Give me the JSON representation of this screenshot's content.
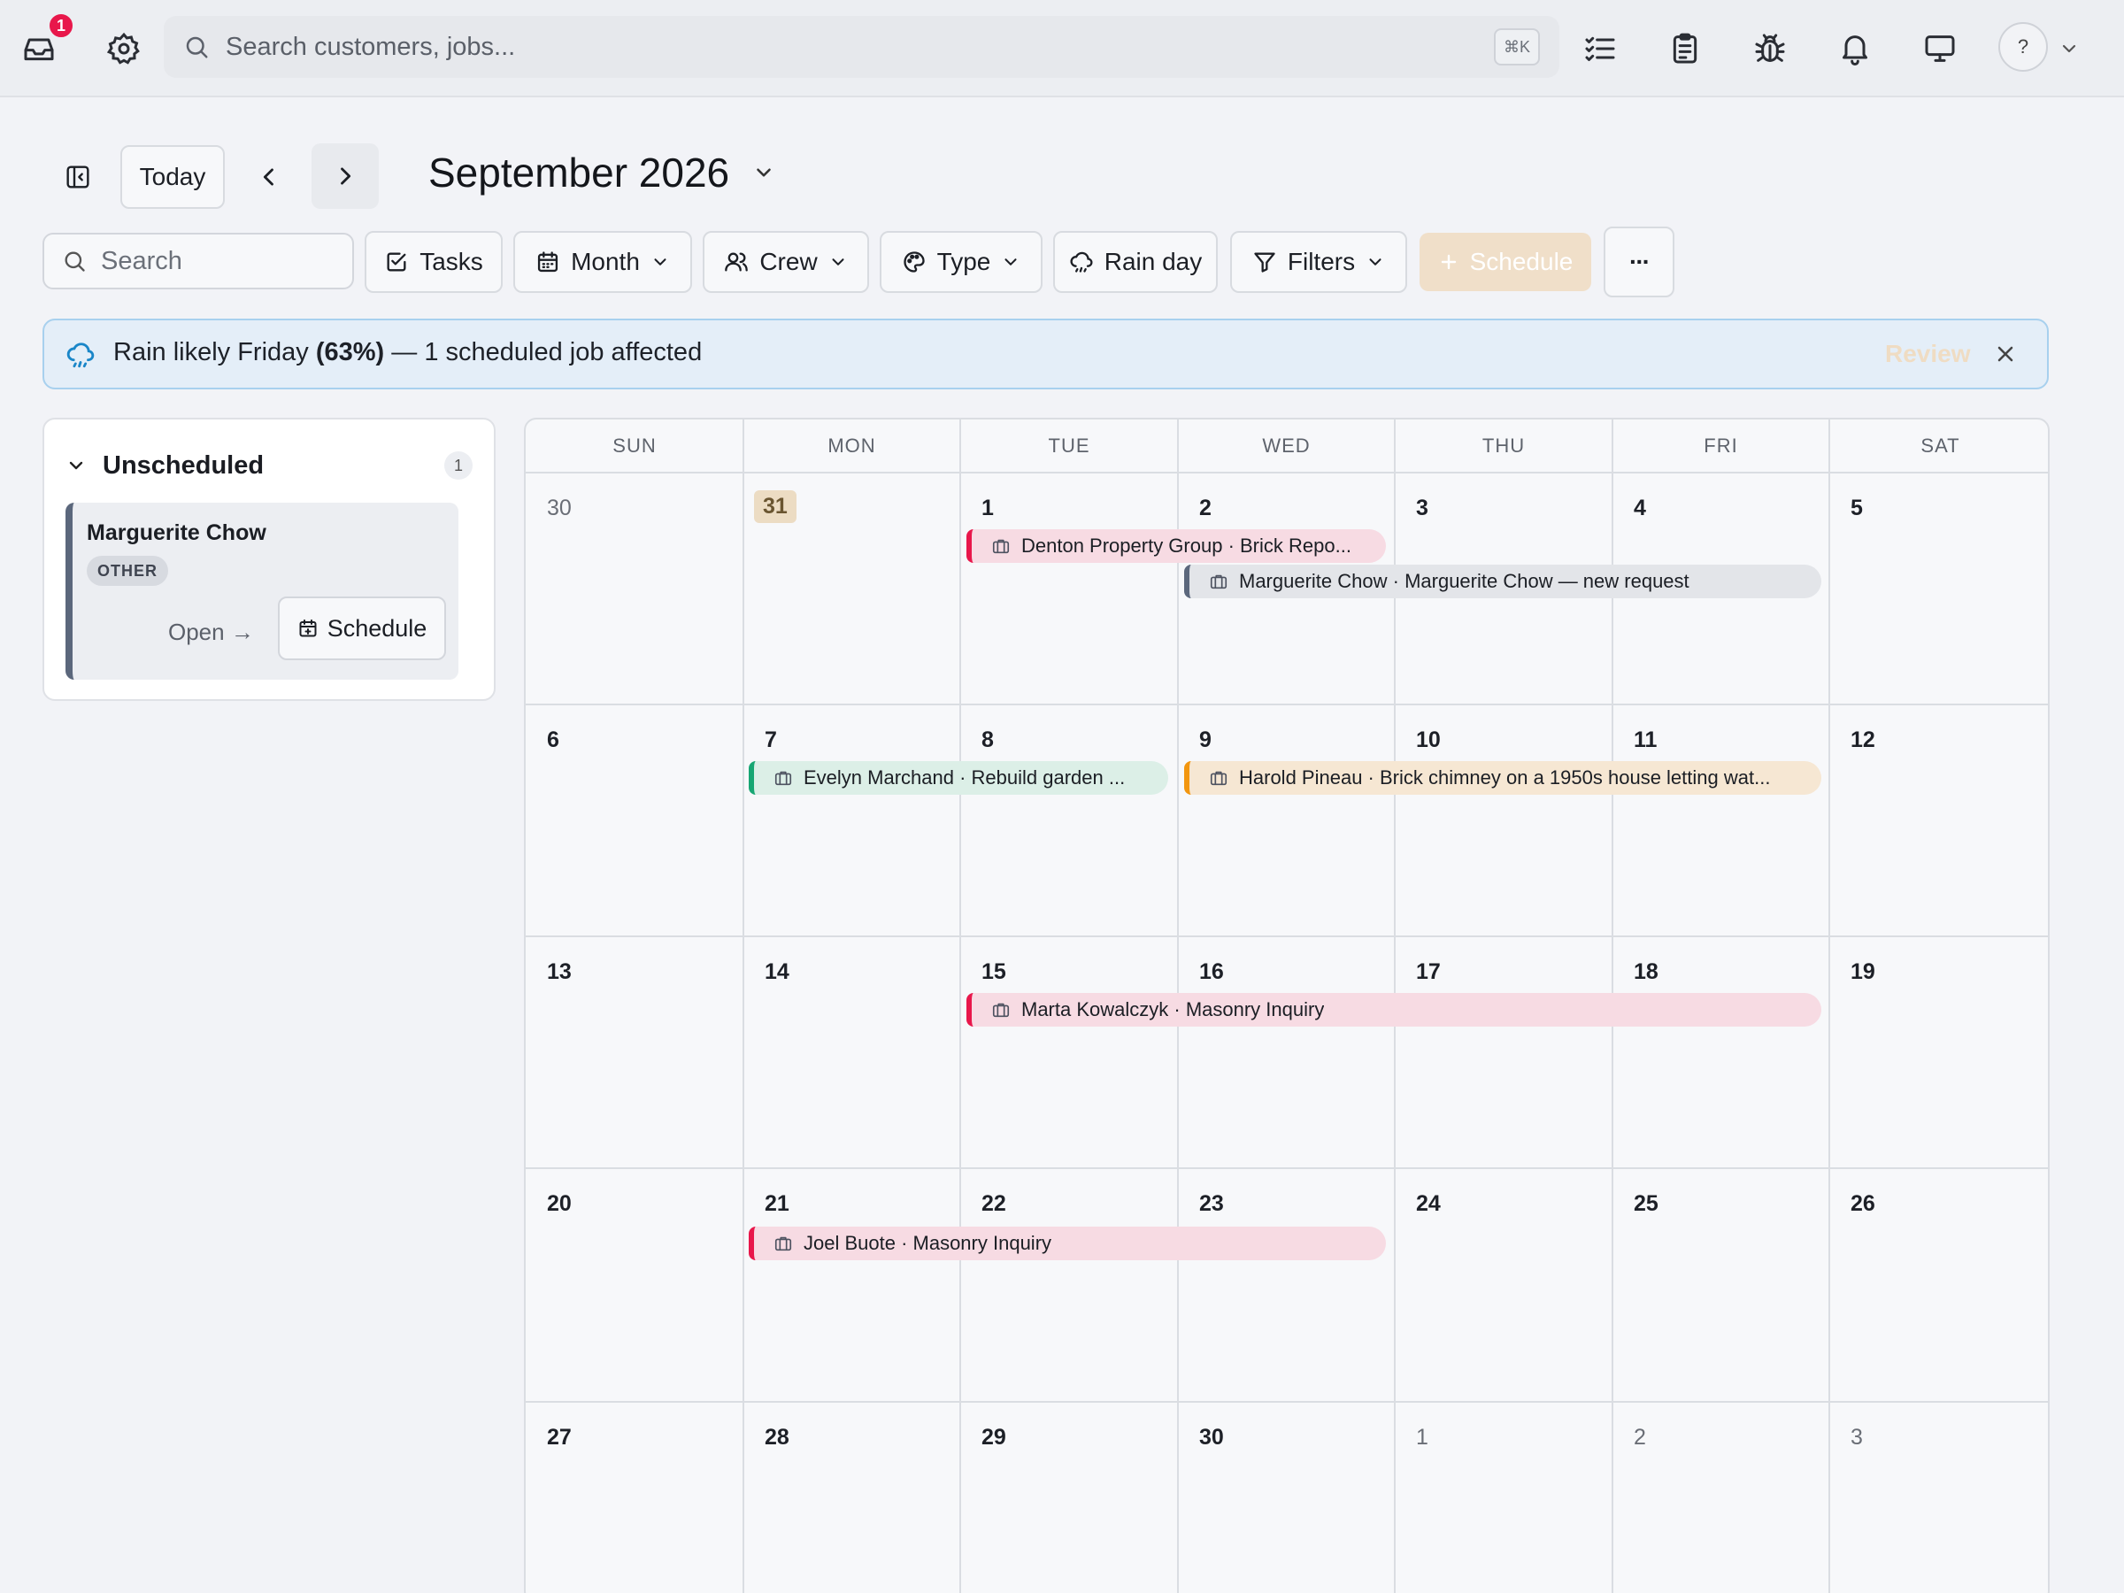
{
  "topbar": {
    "notification_count": "1",
    "search_placeholder": "Search customers, jobs...",
    "shortcut": "⌘K",
    "help_label": "?"
  },
  "header": {
    "today_label": "Today",
    "month_title": "September 2026"
  },
  "filters": {
    "search_placeholder": "Search",
    "tasks_label": "Tasks",
    "view_label": "Month",
    "crew_label": "Crew",
    "type_label": "Type",
    "rain_label": "Rain day",
    "filters_label": "Filters",
    "schedule_label": "Schedule",
    "more_label": "···"
  },
  "banner": {
    "prefix": "Rain likely Friday ",
    "percent": "(63%)",
    "suffix": " — 1 scheduled job affected",
    "action": "Review"
  },
  "unscheduled": {
    "title": "Unscheduled",
    "count": "1",
    "card": {
      "name": "Marguerite Chow",
      "tag": "OTHER",
      "open_label": "Open →",
      "schedule_label": "Schedule"
    }
  },
  "calendar": {
    "weekdays": [
      "SUN",
      "MON",
      "TUE",
      "WED",
      "THU",
      "FRI",
      "SAT"
    ],
    "weeks": [
      [
        "30",
        "31",
        "1",
        "2",
        "3",
        "4",
        "5"
      ],
      [
        "6",
        "7",
        "8",
        "9",
        "10",
        "11",
        "12"
      ],
      [
        "13",
        "14",
        "15",
        "16",
        "17",
        "18",
        "19"
      ],
      [
        "20",
        "21",
        "22",
        "23",
        "24",
        "25",
        "26"
      ],
      [
        "27",
        "28",
        "29",
        "30",
        "1",
        "2",
        "3"
      ]
    ],
    "events": [
      {
        "text": "Denton Property Group · Brick Repo...",
        "color": "#e8174b",
        "fill": "#f7dbe3"
      },
      {
        "text": "Marguerite Chow · Marguerite Chow — new request",
        "color": "#5b677c",
        "fill": "#e3e5e9"
      },
      {
        "text": "Evelyn Marchand · Rebuild garden ...",
        "color": "#17a673",
        "fill": "#dcefe7"
      },
      {
        "text": "Harold Pineau · Brick chimney on a 1950s house letting wat...",
        "color": "#f2960f",
        "fill": "#f6e7d3"
      },
      {
        "text": "Marta Kowalczyk · Masonry Inquiry",
        "color": "#e8174b",
        "fill": "#f7dbe3"
      },
      {
        "text": "Joel Buote · Masonry Inquiry",
        "color": "#e8174b",
        "fill": "#f7dbe3"
      }
    ]
  }
}
